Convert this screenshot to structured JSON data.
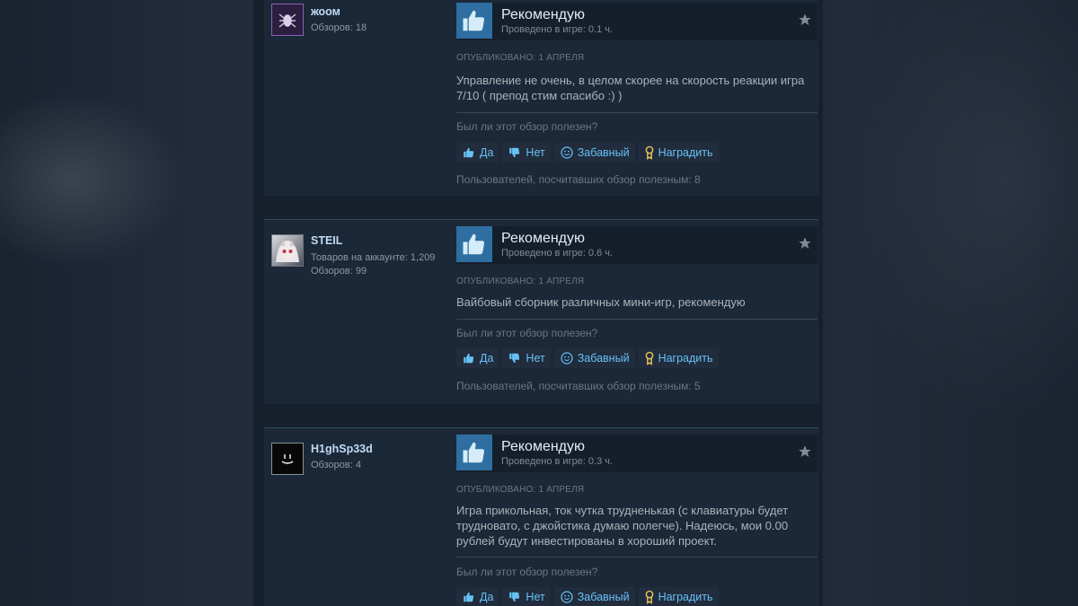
{
  "reviews": [
    {
      "username": "жоом",
      "meta_lines": [
        "Обзоров: 18"
      ],
      "recommendation": "Рекомендую",
      "hours": "Проведено в игре: 0.1 ч.",
      "posted": "ОПУБЛИКОВАНО: 1 АПРЕЛЯ",
      "text": "Управление не очень, в целом скорее на скорость реакции игра 7/10 ( препод стим спасибо :) )",
      "helpful_question": "Был ли этот обзор полезен?",
      "buttons": {
        "yes": "Да",
        "no": "Нет",
        "funny": "Забавный",
        "award": "Наградить"
      },
      "found_helpful": "Пользователей, посчитавших обзор полезным: 8"
    },
    {
      "username": "STEIL",
      "meta_lines": [
        "Товаров на аккаунте: 1,209",
        "Обзоров: 99"
      ],
      "recommendation": "Рекомендую",
      "hours": "Проведено в игре: 0.6 ч.",
      "posted": "ОПУБЛИКОВАНО: 1 АПРЕЛЯ",
      "text": "Вайбовый сборник различных мини-игр, рекомендую",
      "helpful_question": "Был ли этот обзор полезен?",
      "buttons": {
        "yes": "Да",
        "no": "Нет",
        "funny": "Забавный",
        "award": "Наградить"
      },
      "found_helpful": "Пользователей, посчитавших обзор полезным: 5"
    },
    {
      "username": "H1ghSp33d",
      "meta_lines": [
        "Обзоров: 4"
      ],
      "recommendation": "Рекомендую",
      "hours": "Проведено в игре: 0.3 ч.",
      "posted": "ОПУБЛИКОВАНО: 1 АПРЕЛЯ",
      "text": "Игра прикольная, ток чутка трудненькая (с клавиатуры будет трудновато, с джойстика думаю полегче). Надеюсь, мои 0.00 рублей будут инвестированы в хороший проект.",
      "helpful_question": "Был ли этот обзор полезен?",
      "buttons": {
        "yes": "Да",
        "no": "Нет",
        "funny": "Забавный",
        "award": "Наградить"
      },
      "found_helpful": ""
    }
  ],
  "colors": {
    "accent": "#67c1f5",
    "thumb_bg": "#2e6ea0",
    "username": "#c1dbf4"
  },
  "icons": [
    "thumbs-up-icon",
    "thumbs-down-icon",
    "smiley-icon",
    "award-icon",
    "star-icon"
  ]
}
